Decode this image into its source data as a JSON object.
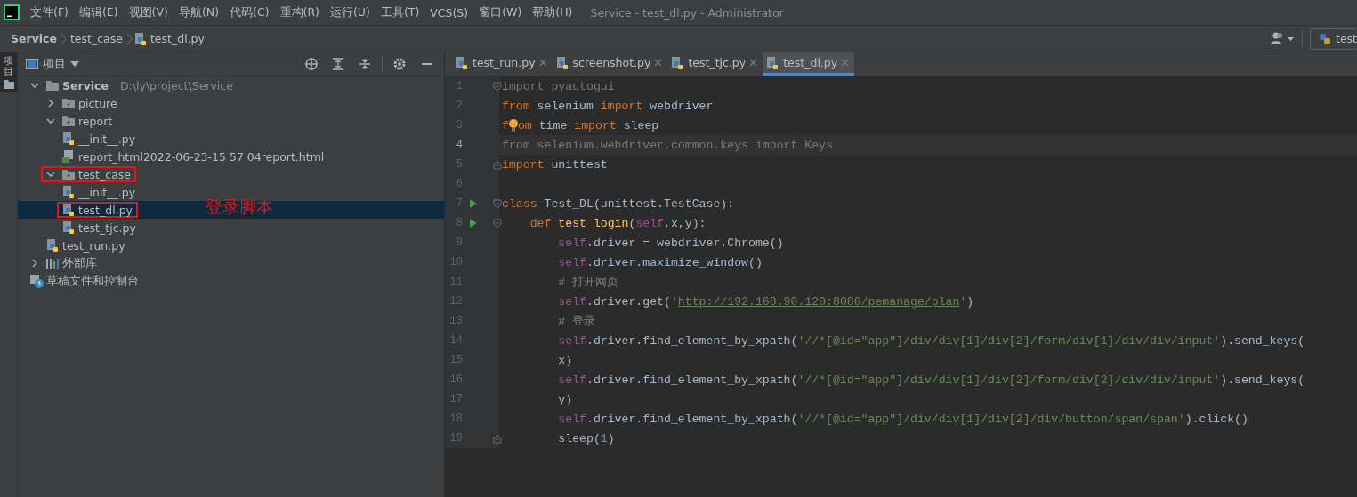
{
  "window": {
    "title": "Service - test_dl.py - Administrator"
  },
  "menu": [
    "文件(F)",
    "编辑(E)",
    "视图(V)",
    "导航(N)",
    "代码(C)",
    "重构(R)",
    "运行(U)",
    "工具(T)",
    "VCS(S)",
    "窗口(W)",
    "帮助(H)"
  ],
  "breadcrumb": [
    "Service",
    "test_case",
    "test_dl.py"
  ],
  "run_config": "test",
  "side_tabs": [
    {
      "label": "项目",
      "selected": true
    }
  ],
  "project_panel": {
    "title": "项目",
    "tree": [
      {
        "label": "Service",
        "path": "D:\\ly\\project\\Service",
        "kind": "root",
        "expanded": true,
        "selected": false,
        "highlighted": false,
        "children": [
          {
            "label": "picture",
            "kind": "folder",
            "expanded": false,
            "selected": false,
            "highlighted": false
          },
          {
            "label": "report",
            "kind": "folder",
            "expanded": true,
            "selected": false,
            "highlighted": false,
            "children": [
              {
                "label": "__init__.py",
                "kind": "python",
                "selected": false,
                "highlighted": false
              },
              {
                "label": "report_html2022-06-23-15 57 04report.html",
                "kind": "html",
                "selected": false,
                "highlighted": false
              }
            ]
          },
          {
            "label": "test_case",
            "kind": "folder",
            "expanded": true,
            "selected": false,
            "highlighted": true,
            "children": [
              {
                "label": "__init__.py",
                "kind": "python",
                "selected": false,
                "highlighted": false
              },
              {
                "label": "test_dl.py",
                "kind": "python",
                "selected": true,
                "highlighted": true,
                "annotation": "登录脚本"
              },
              {
                "label": "test_tjc.py",
                "kind": "python",
                "selected": false,
                "highlighted": false
              }
            ]
          },
          {
            "label": "test_run.py",
            "kind": "python",
            "selected": false,
            "highlighted": false
          }
        ]
      },
      {
        "label": "外部库",
        "kind": "library",
        "expanded": false,
        "selected": false,
        "highlighted": false
      },
      {
        "label": "草稿文件和控制台",
        "kind": "scratch",
        "selected": false,
        "highlighted": false
      }
    ]
  },
  "tabs": [
    {
      "label": "test_run.py",
      "selected": false
    },
    {
      "label": "screenshot.py",
      "selected": false
    },
    {
      "label": "test_tjc.py",
      "selected": false
    },
    {
      "label": "test_dl.py",
      "selected": true
    }
  ],
  "code": [
    {
      "number": "1",
      "fold_start": true,
      "fold_end": false,
      "run": false,
      "current": false,
      "tokens": [
        {
          "kind": "unused",
          "text": "import pyautogui"
        }
      ]
    },
    {
      "number": "2",
      "fold_start": false,
      "fold_end": false,
      "run": false,
      "current": false,
      "tokens": [
        {
          "kind": "kw",
          "text": "from "
        },
        {
          "kind": "plain",
          "text": "selenium "
        },
        {
          "kind": "kw",
          "text": "import "
        },
        {
          "kind": "plain",
          "text": "webdriver"
        }
      ]
    },
    {
      "number": "3",
      "fold_start": false,
      "fold_end": false,
      "run": false,
      "current": false,
      "bulb": true,
      "tokens": [
        {
          "kind": "kw",
          "text": "f"
        },
        {
          "kind": "kw",
          "text": "om "
        },
        {
          "kind": "plain",
          "text": "time "
        },
        {
          "kind": "kw",
          "text": "import "
        },
        {
          "kind": "plain",
          "text": "sleep"
        }
      ]
    },
    {
      "number": "4",
      "fold_start": false,
      "fold_end": false,
      "run": false,
      "current": true,
      "tokens": [
        {
          "kind": "unused",
          "text": "from selenium.webdriver.common.keys import "
        },
        {
          "kind": "unused",
          "text": "Keys"
        }
      ]
    },
    {
      "number": "5",
      "fold_start": false,
      "fold_end": true,
      "run": false,
      "current": false,
      "tokens": [
        {
          "kind": "kw",
          "text": "import "
        },
        {
          "kind": "plain",
          "text": "unittest"
        }
      ]
    },
    {
      "number": "6",
      "fold_start": false,
      "fold_end": false,
      "run": false,
      "current": false
    },
    {
      "number": "7",
      "fold_start": true,
      "fold_end": false,
      "run": true,
      "current": false,
      "tokens": [
        {
          "kind": "kw",
          "text": "class "
        },
        {
          "kind": "plain",
          "text": "Test_DL(unittest.TestCase):"
        }
      ]
    },
    {
      "number": "8",
      "fold_start": true,
      "fold_end": false,
      "run": true,
      "current": false,
      "tokens": [
        {
          "kind": "kw",
          "text": "    def "
        },
        {
          "kind": "fn",
          "text": "test_login"
        },
        {
          "kind": "plain",
          "text": "("
        },
        {
          "kind": "self",
          "text": "self"
        },
        {
          "kind": "plain",
          "text": ",x,y):"
        }
      ]
    },
    {
      "number": "9",
      "fold_start": false,
      "fold_end": false,
      "run": false,
      "current": false,
      "tokens": [
        {
          "kind": "self",
          "text": "        self"
        },
        {
          "kind": "plain",
          "text": ".driver = webdriver.Chrome()"
        }
      ]
    },
    {
      "number": "10",
      "fold_start": false,
      "fold_end": false,
      "run": false,
      "current": false,
      "tokens": [
        {
          "kind": "self",
          "text": "        self"
        },
        {
          "kind": "plain",
          "text": ".driver.maximize_window()"
        }
      ]
    },
    {
      "number": "11",
      "fold_start": false,
      "fold_end": false,
      "run": false,
      "current": false,
      "tokens": [
        {
          "kind": "comment",
          "text": "        # 打开网页"
        }
      ]
    },
    {
      "number": "12",
      "fold_start": false,
      "fold_end": false,
      "run": false,
      "current": false,
      "tokens": [
        {
          "kind": "self",
          "text": "        self"
        },
        {
          "kind": "plain",
          "text": ".driver.get("
        },
        {
          "kind": "str",
          "text": "'"
        },
        {
          "kind": "link",
          "text": "http://192.168.90.120:8080/pemanage/plan"
        },
        {
          "kind": "str",
          "text": "'"
        },
        {
          "kind": "plain",
          "text": ")"
        }
      ]
    },
    {
      "number": "13",
      "fold_start": false,
      "fold_end": false,
      "run": false,
      "current": false,
      "tokens": [
        {
          "kind": "comment",
          "text": "        # 登录"
        }
      ]
    },
    {
      "number": "14",
      "fold_start": false,
      "fold_end": false,
      "run": false,
      "current": false,
      "tokens": [
        {
          "kind": "self",
          "text": "        self"
        },
        {
          "kind": "plain",
          "text": ".driver.find_element_by_xpath("
        },
        {
          "kind": "str",
          "text": "'//*[@id=\"app\"]/div/div[1]/div[2]/form/div[1]/div/div/input'"
        },
        {
          "kind": "plain",
          "text": ").send_keys("
        }
      ]
    },
    {
      "number": "15",
      "fold_start": false,
      "fold_end": false,
      "run": false,
      "current": false,
      "tokens": [
        {
          "kind": "plain",
          "text": "        x)"
        }
      ]
    },
    {
      "number": "16",
      "fold_start": false,
      "fold_end": false,
      "run": false,
      "current": false,
      "tokens": [
        {
          "kind": "self",
          "text": "        self"
        },
        {
          "kind": "plain",
          "text": ".driver.find_element_by_xpath("
        },
        {
          "kind": "str",
          "text": "'//*[@id=\"app\"]/div/div[1]/div[2]/form/div[2]/div/div/input'"
        },
        {
          "kind": "plain",
          "text": ").send_keys("
        }
      ]
    },
    {
      "number": "17",
      "fold_start": false,
      "fold_end": false,
      "run": false,
      "current": false,
      "tokens": [
        {
          "kind": "plain",
          "text": "        y)"
        }
      ]
    },
    {
      "number": "18",
      "fold_start": false,
      "fold_end": false,
      "run": false,
      "current": false,
      "tokens": [
        {
          "kind": "self",
          "text": "        self"
        },
        {
          "kind": "plain",
          "text": ".driver.find_element_by_xpath("
        },
        {
          "kind": "str",
          "text": "'//*[@id=\"app\"]/div/div[1]/div[2]/div/button/span/span'"
        },
        {
          "kind": "plain",
          "text": ").click()"
        }
      ]
    },
    {
      "number": "19",
      "fold_start": false,
      "fold_end": true,
      "run": false,
      "current": false,
      "tokens": [
        {
          "kind": "plain",
          "text": "        sleep("
        },
        {
          "kind": "num",
          "text": "1"
        },
        {
          "kind": "plain",
          "text": ")"
        }
      ]
    }
  ]
}
